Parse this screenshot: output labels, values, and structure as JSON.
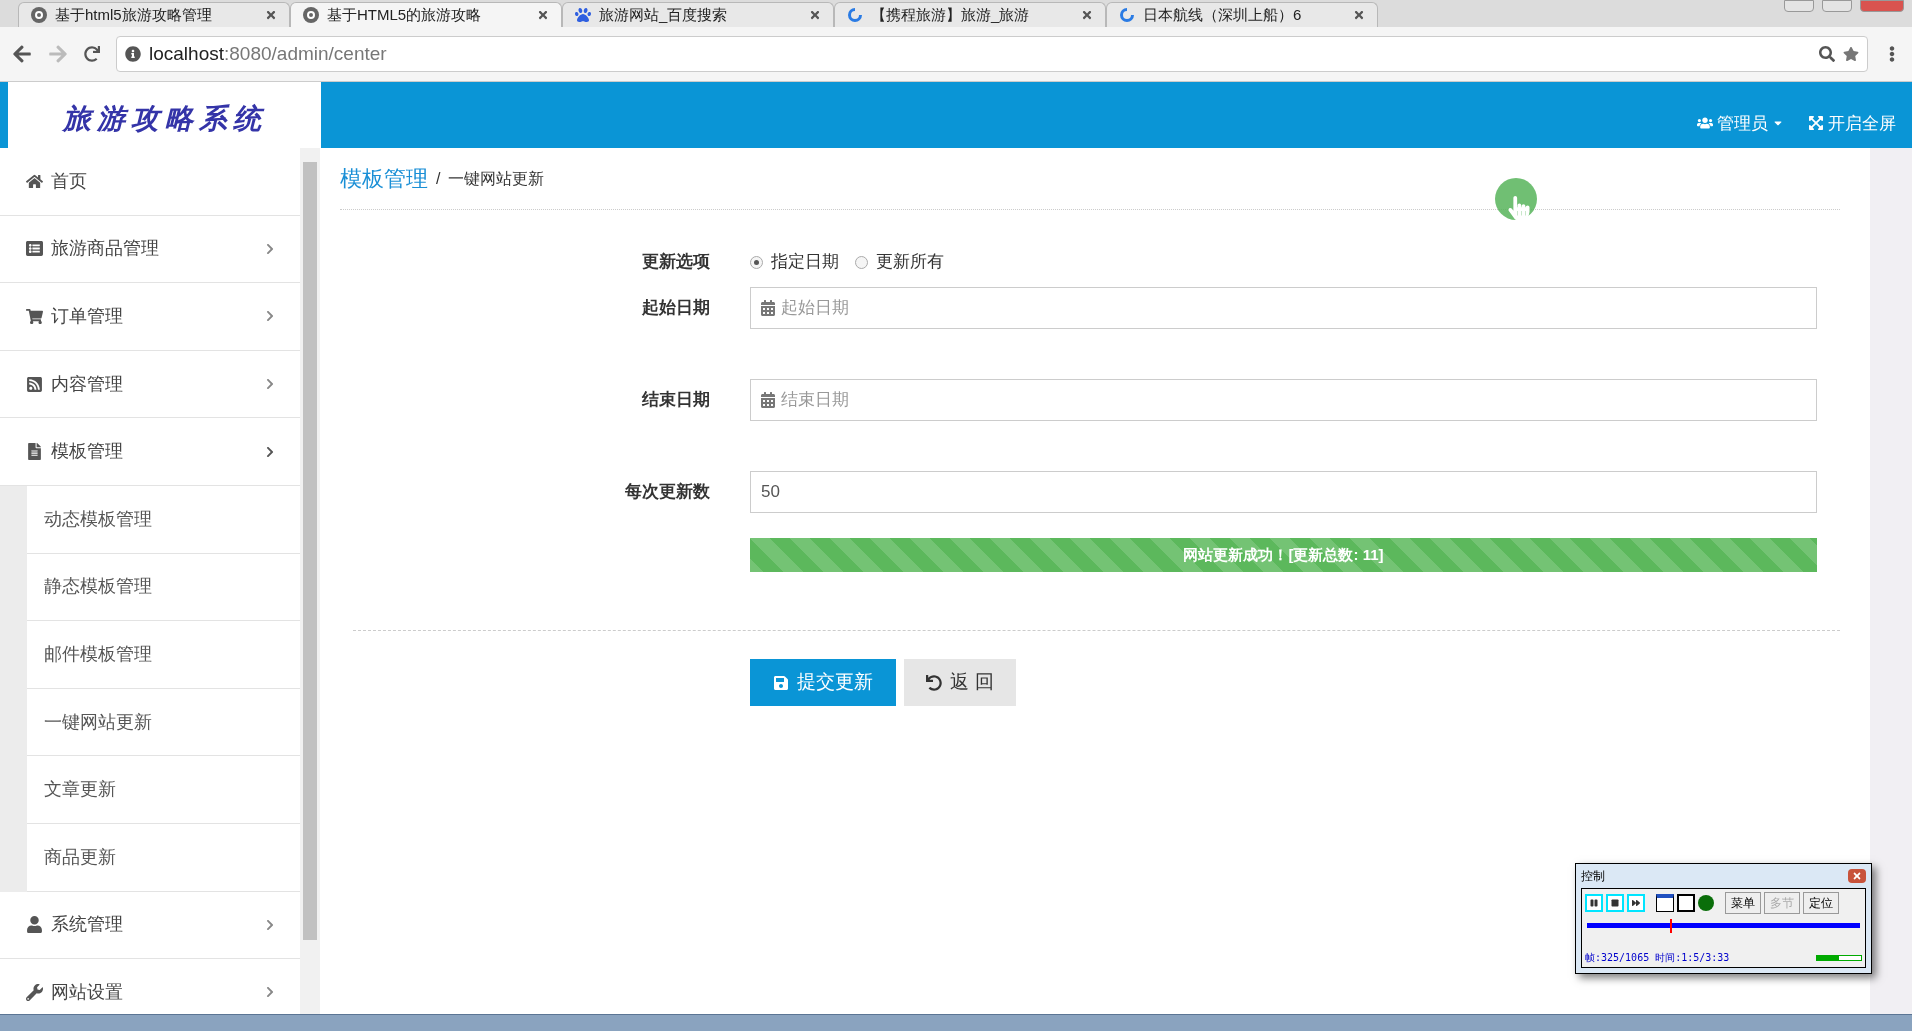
{
  "browser": {
    "tabs": [
      {
        "title": "基于html5旅游攻略管理",
        "selected": false
      },
      {
        "title": "基于HTML5的旅游攻略",
        "selected": true
      },
      {
        "title": "旅游网站_百度搜索",
        "selected": false
      },
      {
        "title": "【携程旅游】旅游_旅游",
        "selected": false
      },
      {
        "title": "日本航线（深圳上船）6",
        "selected": false
      }
    ],
    "url": {
      "host": "localhost",
      "path": ":8080/admin/center"
    }
  },
  "header": {
    "logo": "旅游攻略系统",
    "user": "管理员",
    "fullscreen": "开启全屏"
  },
  "sidebar": {
    "items": [
      {
        "label": "首页",
        "kind": "link"
      },
      {
        "label": "旅游商品管理",
        "kind": "group",
        "expanded": false
      },
      {
        "label": "订单管理",
        "kind": "group",
        "expanded": false
      },
      {
        "label": "内容管理",
        "kind": "group",
        "expanded": false
      },
      {
        "label": "模板管理",
        "kind": "group",
        "expanded": true,
        "children": [
          {
            "label": "动态模板管理"
          },
          {
            "label": "静态模板管理"
          },
          {
            "label": "邮件模板管理"
          },
          {
            "label": "一键网站更新"
          },
          {
            "label": "文章更新"
          },
          {
            "label": "商品更新"
          }
        ]
      },
      {
        "label": "系统管理",
        "kind": "group",
        "expanded": false
      },
      {
        "label": "网站设置",
        "kind": "group",
        "expanded": false
      }
    ]
  },
  "breadcrumb": {
    "section": "模板管理",
    "separator": "/",
    "page": "一键网站更新"
  },
  "form": {
    "option_label": "更新选项",
    "options": [
      {
        "label": "指定日期",
        "selected": true
      },
      {
        "label": "更新所有",
        "selected": false
      }
    ],
    "fields": [
      {
        "label": "起始日期",
        "placeholder": "起始日期",
        "kind": "date"
      },
      {
        "label": "结束日期",
        "placeholder": "结束日期",
        "kind": "date"
      },
      {
        "label": "每次更新数",
        "value": "50",
        "kind": "text"
      }
    ],
    "progress": {
      "text": "网站更新成功！[更新总数: 11]",
      "level": 1
    },
    "buttons": [
      {
        "label": "提交更新",
        "kind": "primary"
      },
      {
        "label": "返 回",
        "kind": "default"
      }
    ]
  },
  "recorder": {
    "title": "控制",
    "text_buttons": [
      {
        "label": "菜单",
        "disabled": false
      },
      {
        "label": "多节",
        "disabled": true
      },
      {
        "label": "定位",
        "disabled": false
      }
    ],
    "timeline": {
      "level": 0.305
    },
    "status": "帧:325/1065 时间:1:5/3:33",
    "volume": {
      "level": 0.5
    }
  }
}
